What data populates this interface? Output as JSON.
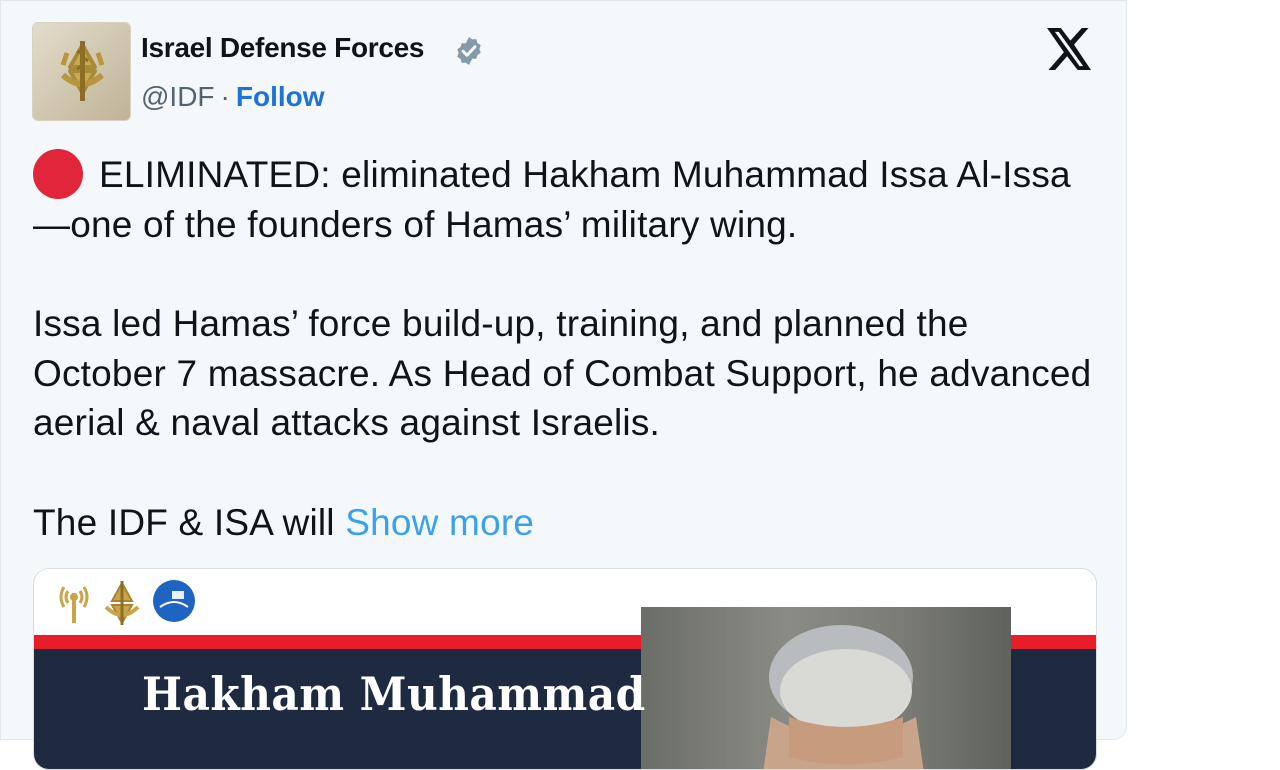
{
  "tweet": {
    "author": {
      "name": "Israel Defense Forces",
      "handle": "@IDF",
      "separator": "·",
      "follow_label": "Follow",
      "verified": true
    },
    "platform_icon": "x-logo-icon",
    "body": {
      "line1_emoji": "red-circle-icon",
      "para1": "ELIMINATED: eliminated Hakham Muhammad Issa Al-Issa—one of the founders of Hamas’ military wing.",
      "para2": "Issa led Hamas’ force build-up, training, and planned the October 7 massacre. As Head of Combat Support, he advanced aerial & naval attacks against Israelis.",
      "para3_prefix": "The IDF & ISA will",
      "show_more_label": "Show more"
    },
    "media": {
      "headline": "Hakham Muhammad",
      "logos": [
        "antenna-logo-icon",
        "idf-emblem-icon",
        "isa-logo-icon"
      ]
    }
  },
  "colors": {
    "background": "#f5f8fa",
    "text": "#0f1419",
    "secondary_text": "#536471",
    "follow": "#1d73d6",
    "show_more": "#3aa1ea",
    "red_dot": "#e1253a",
    "poster_red": "#e81d2a",
    "poster_navy": "#1d2a40"
  }
}
